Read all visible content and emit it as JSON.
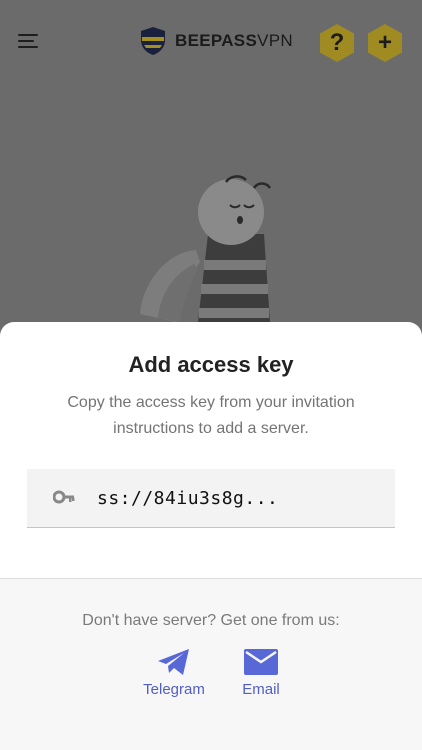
{
  "header": {
    "brand_bold": "BEEPASS",
    "brand_thin": "VPN",
    "help_glyph": "?",
    "add_glyph": "+"
  },
  "sheet": {
    "title": "Add access key",
    "description": "Copy the access key from your invitation instructions to add a server.",
    "key_value": "ss://84iu3s8g...",
    "footer_text": "Don't have server? Get one from us:",
    "providers": [
      {
        "label": "Telegram",
        "icon": "telegram-icon"
      },
      {
        "label": "Email",
        "icon": "email-icon"
      }
    ]
  },
  "colors": {
    "overlay": "#6b6b6b",
    "accent_link": "#4f5ec9",
    "hex_button": "#a08c22"
  }
}
